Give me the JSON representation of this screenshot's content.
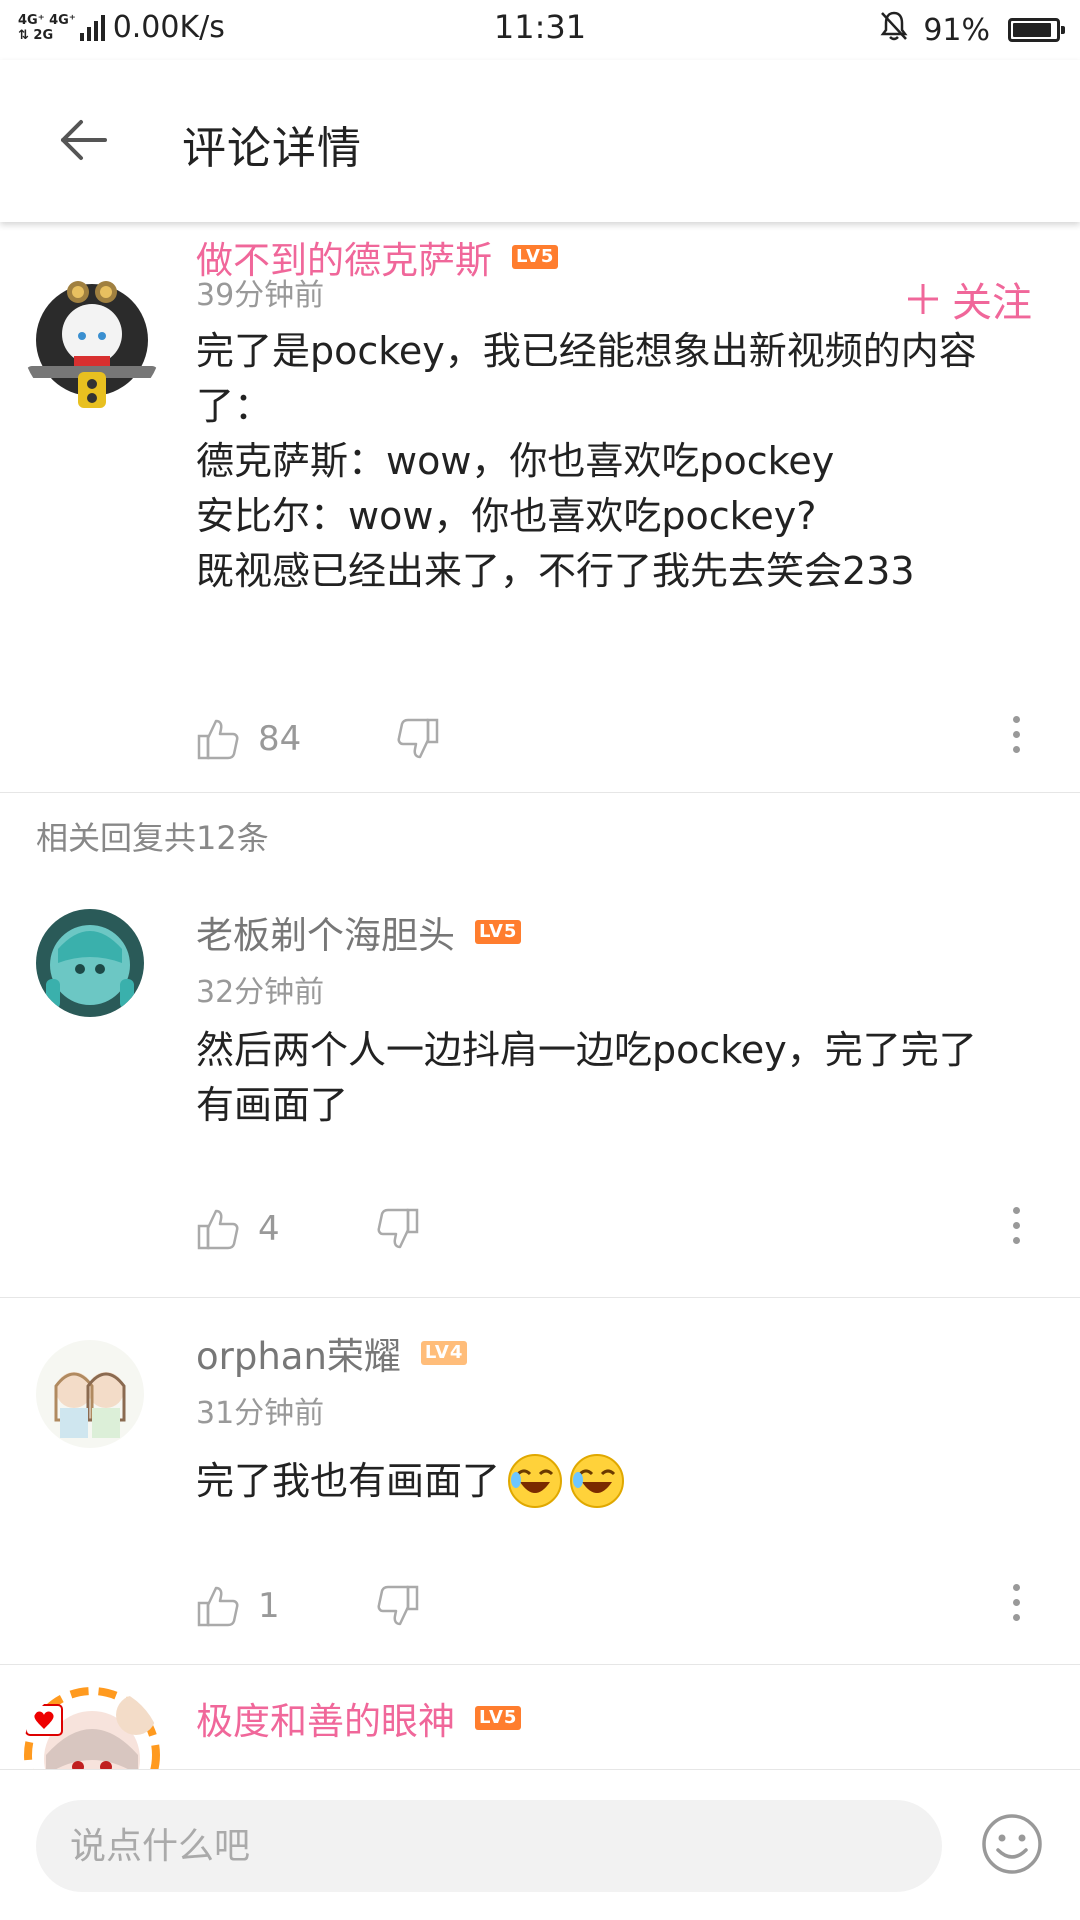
{
  "status_bar": {
    "net_top": "4G⁺ 4G⁺",
    "net_bottom": "⇅  2G",
    "speed": "0.00K/s",
    "time": "11:31",
    "battery_text": "91%",
    "battery_level": 0.91
  },
  "header": {
    "title": "评论详情"
  },
  "main_comment": {
    "username": "做不到的德克萨斯",
    "level": "LV5",
    "time": "39分钟前",
    "follow_label": "关注",
    "text_lines": [
      "完了是pockey，我已经能想象出新视频的内容",
      "了：",
      "德克萨斯：wow，你也喜欢吃pockey",
      "安比尔：wow，你也喜欢吃pockey?",
      "既视感已经出来了，不行了我先去笑会233"
    ],
    "likes": "84"
  },
  "replies_label": "相关回复共12条",
  "replies": [
    {
      "username": "老板剃个海胆头",
      "level": "LV5",
      "time": "32分钟前",
      "text_lines": [
        "然后两个人一边抖肩一边吃pockey，完了完了",
        "有画面了"
      ],
      "likes": "4"
    },
    {
      "username": "orphan荣耀",
      "level": "LV4",
      "time": "31分钟前",
      "text_lines": [
        "完了我也有画面了"
      ],
      "likes": "1"
    },
    {
      "username": "极度和善的眼神",
      "level": "LV5"
    }
  ],
  "input": {
    "placeholder": "说点什么吧"
  },
  "colors": {
    "accent_pink": "#f0679a",
    "level_badge": "#ff7d2e",
    "level_badge_lv4": "#ffbd7a",
    "muted_text": "#999999"
  }
}
